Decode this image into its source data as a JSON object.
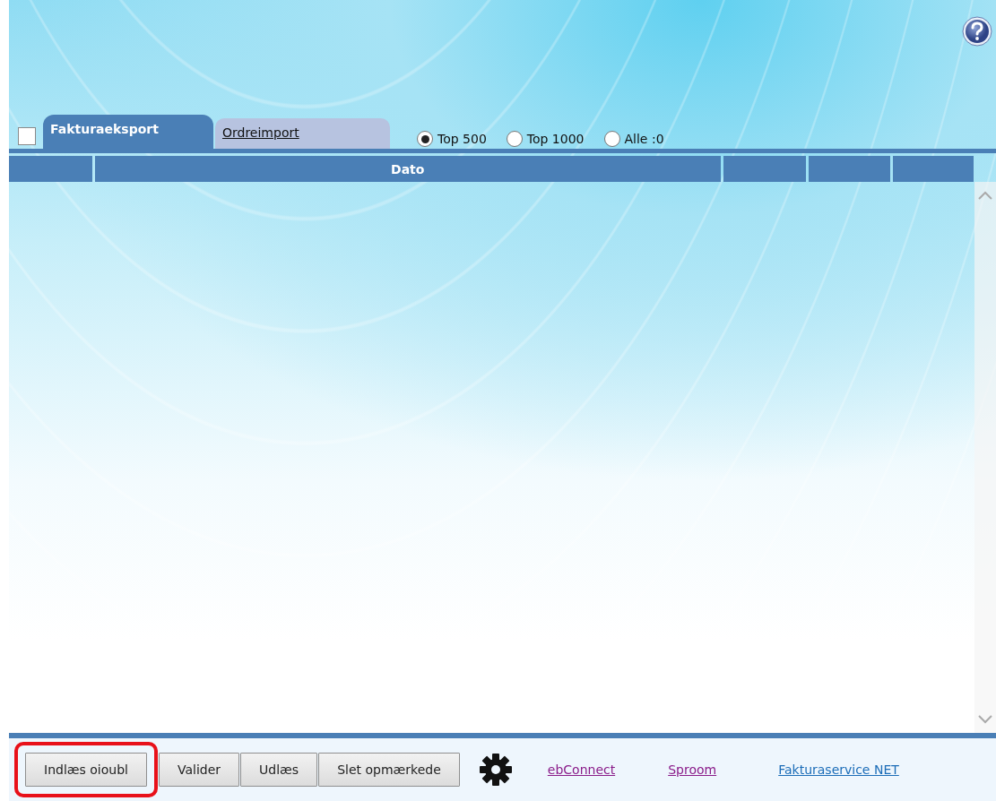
{
  "help": {
    "kind": "help"
  },
  "select_all": {
    "checked": false
  },
  "tabs": [
    {
      "label": "Fakturaeksport",
      "selected": true
    },
    {
      "label": "Ordreimport",
      "selected": false
    }
  ],
  "limit_options": [
    {
      "label": "Top 500",
      "selected": true
    },
    {
      "label": "Top 1000",
      "selected": false
    },
    {
      "label": "Alle :0",
      "selected": false
    }
  ],
  "table": {
    "columns": [
      {
        "kind": "blank"
      },
      {
        "kind": "text",
        "label": "Dato"
      },
      {
        "kind": "blank"
      },
      {
        "kind": "blank"
      },
      {
        "kind": "blank"
      }
    ]
  },
  "buttons": [
    {
      "label": "Indlæs oioubl",
      "highlighted": true
    },
    {
      "label": "Valider",
      "highlighted": false
    },
    {
      "label": "Udlæs",
      "highlighted": false
    },
    {
      "label": "Slet opmærkede",
      "highlighted": false
    }
  ],
  "settings": {
    "kind": "gear"
  },
  "links": [
    {
      "label": "ebConnect",
      "visited": true
    },
    {
      "label": "Sproom",
      "visited": true
    },
    {
      "label": "Fakturaservice NET",
      "visited": false
    }
  ]
}
